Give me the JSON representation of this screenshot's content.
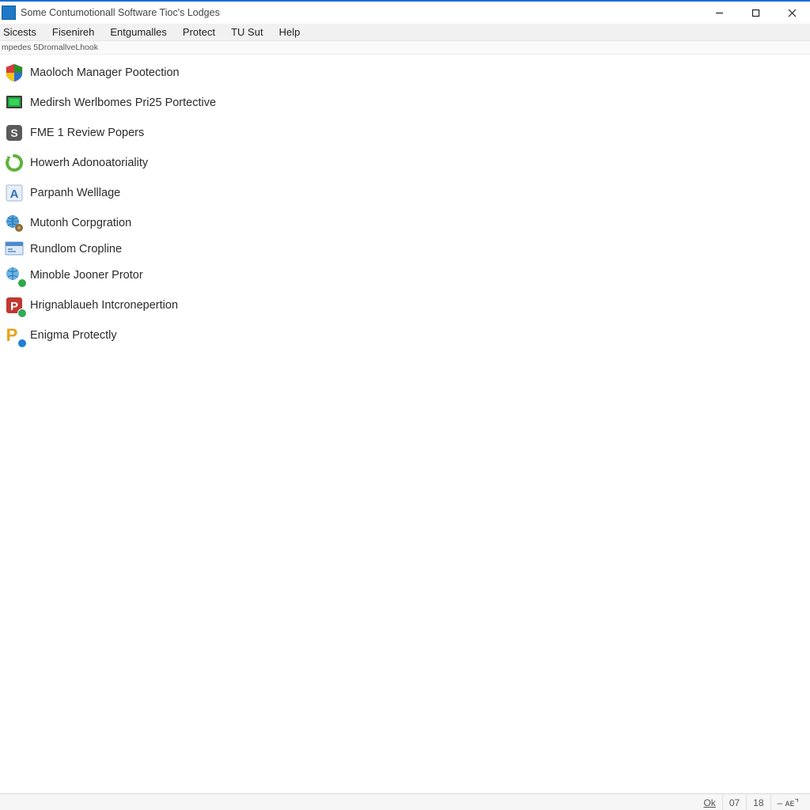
{
  "window": {
    "title": "Some Contumotionall Software Tioc's Lodges"
  },
  "menu": {
    "items": [
      "Sicests",
      "Fisenireh",
      "Entgumalles",
      "Protect",
      "TU Sut",
      "Help"
    ]
  },
  "subheader": {
    "text": "mpedes 5DromallveLhook"
  },
  "programs": [
    {
      "icon": "shield-multicolor-icon",
      "label": "Maoloch Manager Pootection"
    },
    {
      "icon": "monitor-green-icon",
      "label": "Medirsh Werlbomes Pri25 Portective"
    },
    {
      "icon": "tile-grey-s-icon",
      "label": "FME 1 Review Popers"
    },
    {
      "icon": "swirl-green-icon",
      "label": "Howerh Adonoatoriality"
    },
    {
      "icon": "tile-blue-a-icon",
      "label": "Parpanh Welllage"
    },
    {
      "icon": "globe-gear-icon",
      "label": "Mutonh Corpgration"
    },
    {
      "icon": "window-blue-icon",
      "label": "Rundlom Cropline",
      "compact": true
    },
    {
      "icon": "globe-magnify-icon",
      "label": "Minoble Jooner Protor"
    },
    {
      "icon": "tile-red-p-icon",
      "label": "Hrignablaueh Intcronepertion"
    },
    {
      "icon": "p-yellow-badge-icon",
      "label": "Enigma Protectly"
    }
  ],
  "status": {
    "ok": "Ok",
    "num1": "07",
    "num2": "18",
    "extra": "–  ᴀᴇ⌝"
  }
}
